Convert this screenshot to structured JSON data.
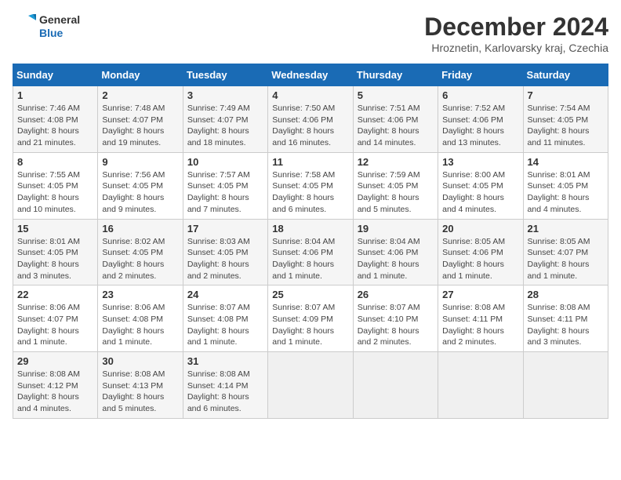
{
  "logo": {
    "line1": "General",
    "line2": "Blue"
  },
  "title": "December 2024",
  "subtitle": "Hroznetin, Karlovarsky kraj, Czechia",
  "weekdays": [
    "Sunday",
    "Monday",
    "Tuesday",
    "Wednesday",
    "Thursday",
    "Friday",
    "Saturday"
  ],
  "weeks": [
    [
      {
        "day": "1",
        "info": "Sunrise: 7:46 AM\nSunset: 4:08 PM\nDaylight: 8 hours and 21 minutes."
      },
      {
        "day": "2",
        "info": "Sunrise: 7:48 AM\nSunset: 4:07 PM\nDaylight: 8 hours and 19 minutes."
      },
      {
        "day": "3",
        "info": "Sunrise: 7:49 AM\nSunset: 4:07 PM\nDaylight: 8 hours and 18 minutes."
      },
      {
        "day": "4",
        "info": "Sunrise: 7:50 AM\nSunset: 4:06 PM\nDaylight: 8 hours and 16 minutes."
      },
      {
        "day": "5",
        "info": "Sunrise: 7:51 AM\nSunset: 4:06 PM\nDaylight: 8 hours and 14 minutes."
      },
      {
        "day": "6",
        "info": "Sunrise: 7:52 AM\nSunset: 4:06 PM\nDaylight: 8 hours and 13 minutes."
      },
      {
        "day": "7",
        "info": "Sunrise: 7:54 AM\nSunset: 4:05 PM\nDaylight: 8 hours and 11 minutes."
      }
    ],
    [
      {
        "day": "8",
        "info": "Sunrise: 7:55 AM\nSunset: 4:05 PM\nDaylight: 8 hours and 10 minutes."
      },
      {
        "day": "9",
        "info": "Sunrise: 7:56 AM\nSunset: 4:05 PM\nDaylight: 8 hours and 9 minutes."
      },
      {
        "day": "10",
        "info": "Sunrise: 7:57 AM\nSunset: 4:05 PM\nDaylight: 8 hours and 7 minutes."
      },
      {
        "day": "11",
        "info": "Sunrise: 7:58 AM\nSunset: 4:05 PM\nDaylight: 8 hours and 6 minutes."
      },
      {
        "day": "12",
        "info": "Sunrise: 7:59 AM\nSunset: 4:05 PM\nDaylight: 8 hours and 5 minutes."
      },
      {
        "day": "13",
        "info": "Sunrise: 8:00 AM\nSunset: 4:05 PM\nDaylight: 8 hours and 4 minutes."
      },
      {
        "day": "14",
        "info": "Sunrise: 8:01 AM\nSunset: 4:05 PM\nDaylight: 8 hours and 4 minutes."
      }
    ],
    [
      {
        "day": "15",
        "info": "Sunrise: 8:01 AM\nSunset: 4:05 PM\nDaylight: 8 hours and 3 minutes."
      },
      {
        "day": "16",
        "info": "Sunrise: 8:02 AM\nSunset: 4:05 PM\nDaylight: 8 hours and 2 minutes."
      },
      {
        "day": "17",
        "info": "Sunrise: 8:03 AM\nSunset: 4:05 PM\nDaylight: 8 hours and 2 minutes."
      },
      {
        "day": "18",
        "info": "Sunrise: 8:04 AM\nSunset: 4:06 PM\nDaylight: 8 hours and 1 minute."
      },
      {
        "day": "19",
        "info": "Sunrise: 8:04 AM\nSunset: 4:06 PM\nDaylight: 8 hours and 1 minute."
      },
      {
        "day": "20",
        "info": "Sunrise: 8:05 AM\nSunset: 4:06 PM\nDaylight: 8 hours and 1 minute."
      },
      {
        "day": "21",
        "info": "Sunrise: 8:05 AM\nSunset: 4:07 PM\nDaylight: 8 hours and 1 minute."
      }
    ],
    [
      {
        "day": "22",
        "info": "Sunrise: 8:06 AM\nSunset: 4:07 PM\nDaylight: 8 hours and 1 minute."
      },
      {
        "day": "23",
        "info": "Sunrise: 8:06 AM\nSunset: 4:08 PM\nDaylight: 8 hours and 1 minute."
      },
      {
        "day": "24",
        "info": "Sunrise: 8:07 AM\nSunset: 4:08 PM\nDaylight: 8 hours and 1 minute."
      },
      {
        "day": "25",
        "info": "Sunrise: 8:07 AM\nSunset: 4:09 PM\nDaylight: 8 hours and 1 minute."
      },
      {
        "day": "26",
        "info": "Sunrise: 8:07 AM\nSunset: 4:10 PM\nDaylight: 8 hours and 2 minutes."
      },
      {
        "day": "27",
        "info": "Sunrise: 8:08 AM\nSunset: 4:11 PM\nDaylight: 8 hours and 2 minutes."
      },
      {
        "day": "28",
        "info": "Sunrise: 8:08 AM\nSunset: 4:11 PM\nDaylight: 8 hours and 3 minutes."
      }
    ],
    [
      {
        "day": "29",
        "info": "Sunrise: 8:08 AM\nSunset: 4:12 PM\nDaylight: 8 hours and 4 minutes."
      },
      {
        "day": "30",
        "info": "Sunrise: 8:08 AM\nSunset: 4:13 PM\nDaylight: 8 hours and 5 minutes."
      },
      {
        "day": "31",
        "info": "Sunrise: 8:08 AM\nSunset: 4:14 PM\nDaylight: 8 hours and 6 minutes."
      },
      {
        "day": "",
        "info": ""
      },
      {
        "day": "",
        "info": ""
      },
      {
        "day": "",
        "info": ""
      },
      {
        "day": "",
        "info": ""
      }
    ]
  ]
}
